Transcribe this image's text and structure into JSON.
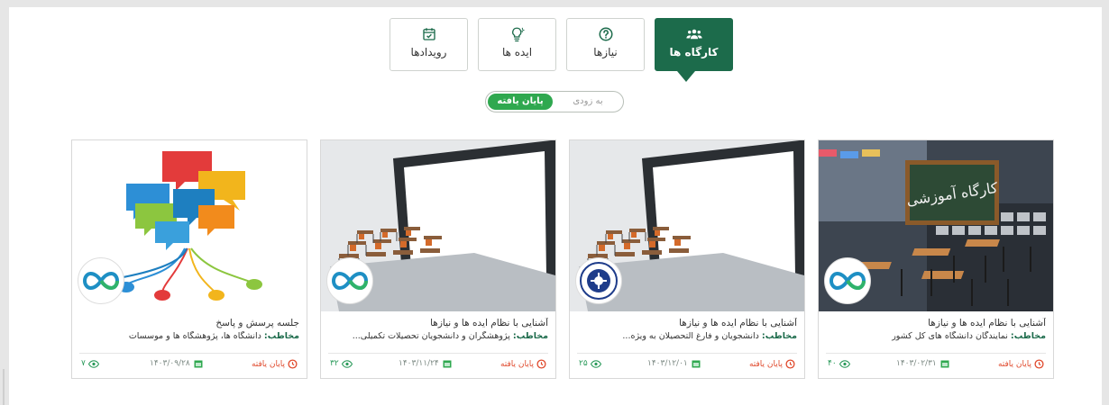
{
  "tabs": [
    {
      "label": "کارگاه ها",
      "icon": "users-icon",
      "active": true
    },
    {
      "label": "نیازها",
      "icon": "question-icon",
      "active": false
    },
    {
      "label": "ایده ها",
      "icon": "lightbulb-icon",
      "active": false
    },
    {
      "label": "رویدادها",
      "icon": "calendar-check-icon",
      "active": false
    }
  ],
  "filter": {
    "past": "پایان یافته",
    "upcoming": "به زودی",
    "selected": "past"
  },
  "audience_label": "مخاطب:",
  "colors": {
    "brand": "#1c6b4b",
    "toggle_active": "#2fa84f",
    "status": "#e0492c"
  },
  "cards": [
    {
      "title": "آشنایی با نظام ایده ها و نیازها",
      "audience": " نمایندگان دانشگاه های کل کشور",
      "status": "پایان یافته",
      "date": "۱۴۰۳/۰۲/۳۱",
      "views": "۴۰",
      "image": "workshop-chalkboard-image",
      "logo": "infinity-logo"
    },
    {
      "title": "آشنایی با نظام ایده ها و نیازها",
      "audience": " دانشجویان و فارغ التحصیلان به ویژه...",
      "status": "پایان یافته",
      "date": "۱۴۰۳/۱۲/۰۱",
      "views": "۲۵",
      "image": "laptop-classroom-image",
      "logo": "university-seal-logo"
    },
    {
      "title": "آشنایی با نظام ایده ها و نیازها",
      "audience": " پژوهشگران و دانشجویان تحصیلات تکمیلی...",
      "status": "پایان یافته",
      "date": "۱۴۰۳/۱۱/۲۴",
      "views": "۳۲",
      "image": "laptop-classroom-image",
      "logo": "infinity-logo"
    },
    {
      "title": "جلسه پرسش و پاسخ",
      "audience": " دانشگاه ها، پژوهشگاه ها و موسسات",
      "status": "پایان یافته",
      "date": "۱۴۰۳/۰۹/۲۸",
      "views": "۷",
      "image": "speech-bubbles-image",
      "logo": "infinity-logo"
    }
  ]
}
